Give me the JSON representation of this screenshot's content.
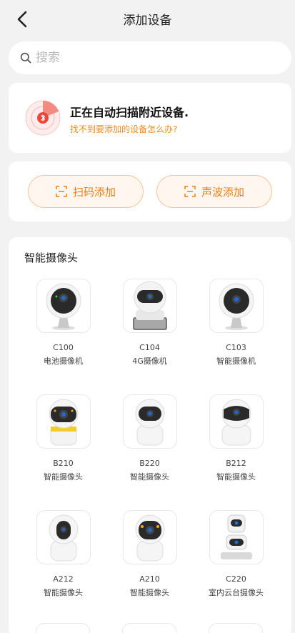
{
  "header": {
    "title": "添加设备"
  },
  "search": {
    "placeholder": "搜索"
  },
  "scan": {
    "title": "正在自动扫描附近设备.",
    "help": "找不到要添加的设备怎么办?"
  },
  "methods": {
    "qr_label": "扫码添加",
    "sound_label": "声波添加"
  },
  "devices": {
    "section_title": "智能摄像头",
    "items": [
      {
        "model": "C100",
        "desc": "电池摄像机"
      },
      {
        "model": "C104",
        "desc": "4G摄像机"
      },
      {
        "model": "C103",
        "desc": "智能摄像机"
      },
      {
        "model": "B210",
        "desc": "智能摄像头"
      },
      {
        "model": "B220",
        "desc": "智能摄像头"
      },
      {
        "model": "B212",
        "desc": "智能摄像头"
      },
      {
        "model": "A212",
        "desc": "智能摄像头"
      },
      {
        "model": "A210",
        "desc": "智能摄像头"
      },
      {
        "model": "C220",
        "desc": "室内云台摄像头"
      }
    ]
  },
  "colors": {
    "accent": "#ee7d14",
    "scan_red": "#e8473a"
  }
}
